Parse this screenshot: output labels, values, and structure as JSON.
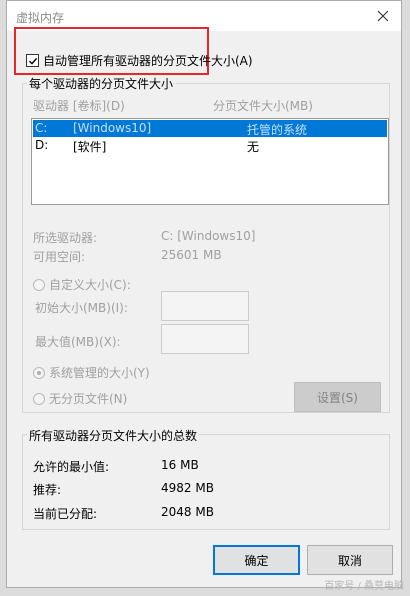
{
  "window": {
    "title": "虚拟内存"
  },
  "auto_manage": {
    "label": "自动管理所有驱动器的分页文件大小(A)",
    "checked": true
  },
  "per_drive": {
    "group_title": "每个驱动器的分页文件大小",
    "headers": {
      "drive": "驱动器 [卷标](D)",
      "size": "分页文件大小(MB)"
    },
    "rows": [
      {
        "drive": "C:",
        "label": "[Windows10]",
        "size": "托管的系统",
        "selected": true
      },
      {
        "drive": "D:",
        "label": "[软件]",
        "size": "无",
        "selected": false
      }
    ],
    "selected_drive_label": "所选驱动器:",
    "selected_drive_value": "C:  [Windows10]",
    "free_space_label": "可用空间:",
    "free_space_value": "25601 MB",
    "custom_size_label": "自定义大小(C):",
    "initial_size_label": "初始大小(MB)(I):",
    "max_size_label": "最大值(MB)(X):",
    "system_managed_label": "系统管理的大小(Y)",
    "no_paging_label": "无分页文件(N)",
    "set_button": "设置(S)"
  },
  "totals": {
    "group_title": "所有驱动器分页文件大小的总数",
    "min_label": "允许的最小值:",
    "min_value": "16 MB",
    "recommended_label": "推荐:",
    "recommended_value": "4982 MB",
    "allocated_label": "当前已分配:",
    "allocated_value": "2048 MB"
  },
  "buttons": {
    "ok": "确定",
    "cancel": "取消"
  },
  "watermark": "百家号 / 桑莫电脑",
  "colors": {
    "highlight_box": "#e8262b",
    "selection": "#0078d7"
  }
}
